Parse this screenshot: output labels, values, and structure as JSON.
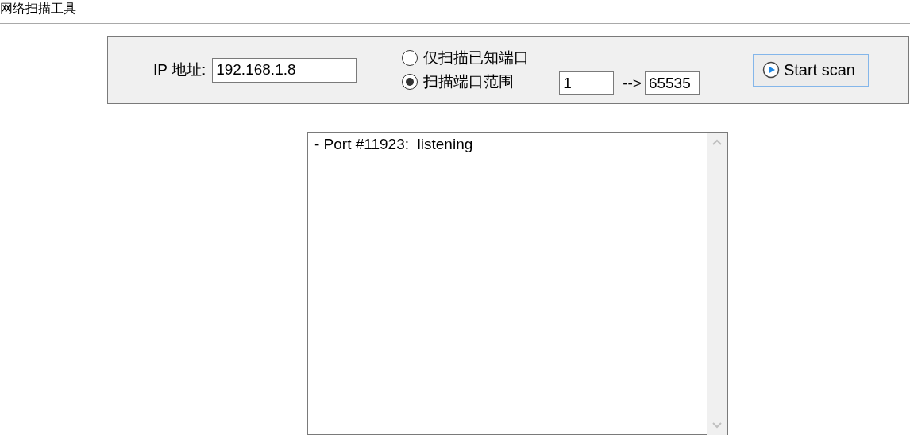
{
  "title": "网络扫描工具",
  "ip": {
    "label": "IP 地址:",
    "value": "192.168.1.8"
  },
  "scan_modes": [
    {
      "label": "仅扫描已知端口",
      "selected": false
    },
    {
      "label": "扫描端口范围",
      "selected": true
    }
  ],
  "range": {
    "from": "1",
    "separator": "-->",
    "to": "65535"
  },
  "start_button": {
    "label": "Start scan"
  },
  "output": {
    "lines": [
      "- Port #11923:  listening"
    ]
  }
}
